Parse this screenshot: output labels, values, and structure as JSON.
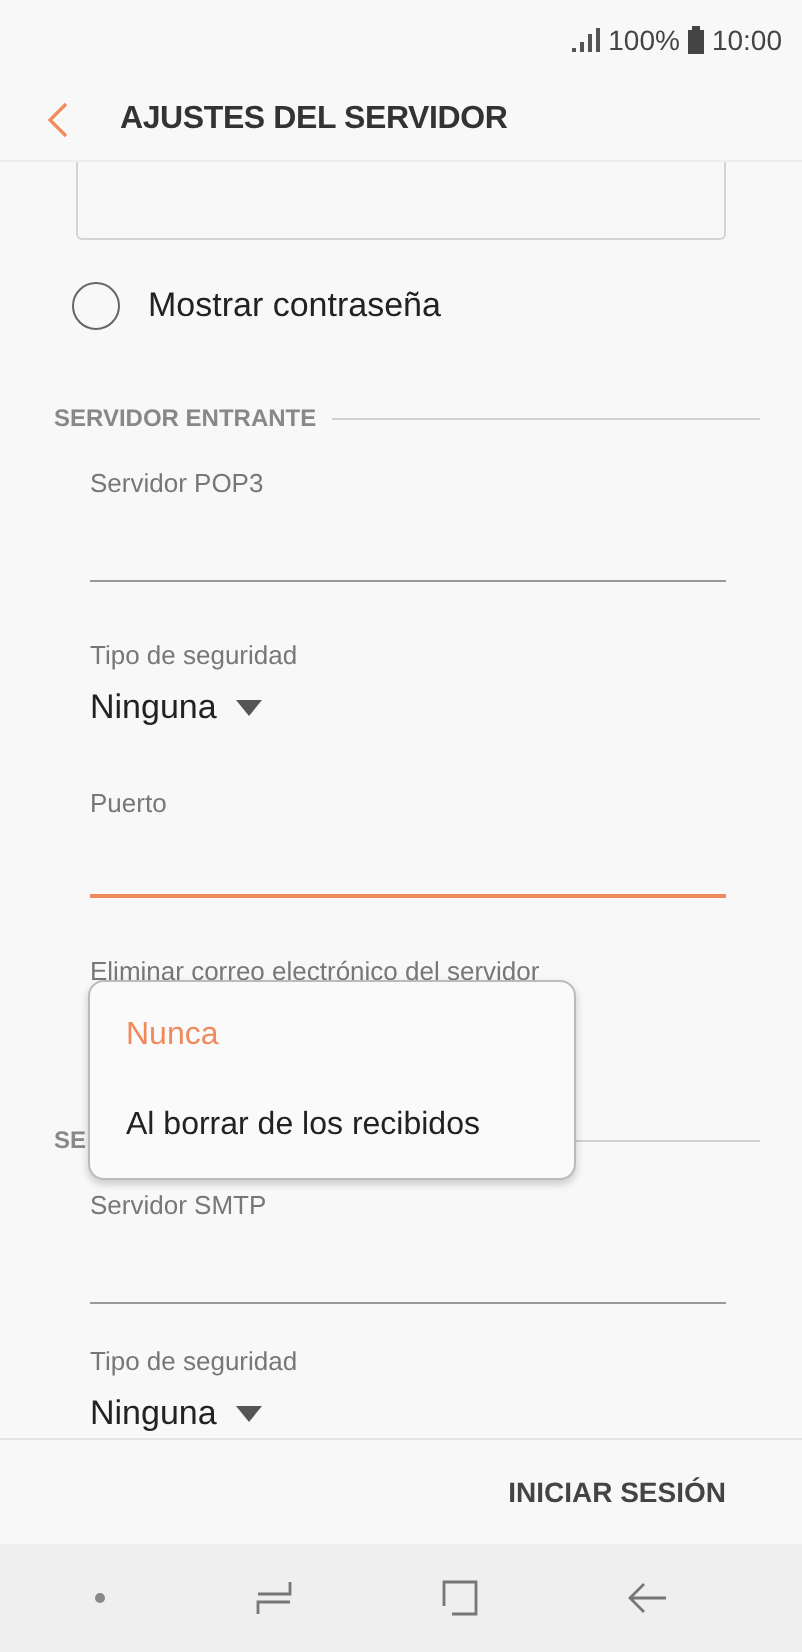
{
  "status_bar": {
    "battery": "100%",
    "time": "10:00"
  },
  "header": {
    "title": "AJUSTES DEL SERVIDOR"
  },
  "form": [
    {
      "kind": "password_box"
    },
    {
      "kind": "radio",
      "label": "Mostrar contraseña",
      "checked": false
    },
    {
      "kind": "section",
      "title": "SERVIDOR ENTRANTE"
    },
    {
      "kind": "text_field",
      "label": "Servidor POP3",
      "focused": false
    },
    {
      "kind": "select",
      "label": "Tipo de seguridad",
      "value": "Ninguna"
    },
    {
      "kind": "text_field",
      "label": "Puerto",
      "focused": true
    },
    {
      "kind": "select",
      "label": "Eliminar correo electrónico del servidor"
    },
    {
      "kind": "section",
      "title": "SE"
    },
    {
      "kind": "text_field",
      "label": "Servidor SMTP",
      "focused": false
    },
    {
      "kind": "select",
      "label": "Tipo de seguridad",
      "value": "Ninguna"
    }
  ],
  "popup": {
    "options": [
      {
        "label": "Nunca",
        "selected": true
      },
      {
        "label": "Al borrar de los recibidos",
        "selected": false
      }
    ]
  },
  "footer": {
    "button": "INICIAR SESIÓN"
  }
}
